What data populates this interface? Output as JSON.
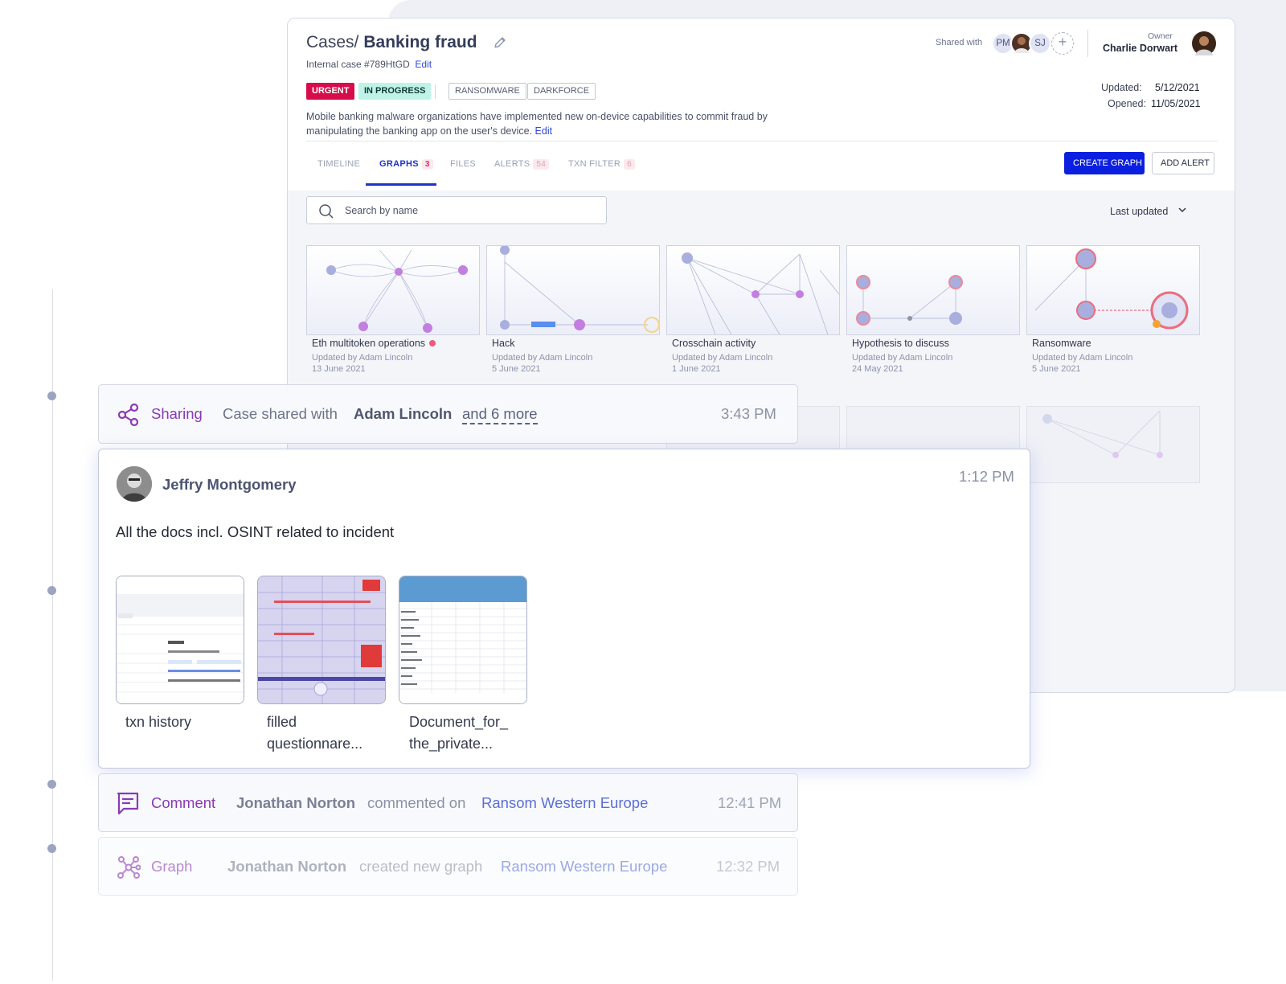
{
  "case": {
    "crumb": "Cases/",
    "title": "Banking fraud",
    "internal_label": "Internal case #789HtGD",
    "internal_edit": "Edit",
    "tags": {
      "urgent": "URGENT",
      "progress": "IN PROGRESS",
      "ransomware": "RANSOMWARE",
      "darkforce": "DARKFORCE"
    },
    "description": "Mobile banking malware organizations have implemented new on-device capabilities to commit fraud by manipulating the banking app on the user's device.",
    "description_edit": "Edit",
    "shared_with_label": "Shared with",
    "shared_avatars": [
      "PM",
      "SJ"
    ],
    "add_symbol": "+",
    "owner_label": "Owner",
    "owner_name": "Charlie Dorwart",
    "updated_label": "Updated:",
    "updated_value": "5/12/2021",
    "opened_label": "Opened:",
    "opened_value": "11/05/2021",
    "tabs": [
      {
        "label": "TIMELINE",
        "count": ""
      },
      {
        "label": "GRAPHS",
        "count": "3"
      },
      {
        "label": "FILES",
        "count": ""
      },
      {
        "label": "ALERTS",
        "count": "54"
      },
      {
        "label": "TXN FILTER",
        "count": "6"
      }
    ],
    "create_graph": "CREATE GRAPH",
    "add_alert": "ADD ALERT",
    "search_placeholder": "Search by name",
    "sort_label": "Last updated",
    "graphs": [
      {
        "name": "Eth multitoken operations",
        "by": "Updated by Adam Lincoln",
        "date": "13 June 2021"
      },
      {
        "name": "Hack",
        "by": "Updated by Adam Lincoln",
        "date": "5 June 2021"
      },
      {
        "name": "Crosschain activity",
        "by": "Updated by Adam Lincoln",
        "date": "1 June 2021"
      },
      {
        "name": "Hypothesis to discuss",
        "by": "Updated by Adam Lincoln",
        "date": "24 May 2021"
      },
      {
        "name": "Ransomware",
        "by": "Updated by Adam Lincoln",
        "date": "5 June 2021"
      }
    ]
  },
  "timeline": {
    "sharing": {
      "category": "Sharing",
      "text": "Case shared with",
      "user": "Adam Lincoln",
      "more": "and 6 more",
      "time": "3:43 PM"
    },
    "message": {
      "author": "Jeffry Montgomery",
      "time": "1:12 PM",
      "text": "All the docs incl. OSINT related to incident",
      "files": [
        {
          "name_line1": "txn history",
          "name_line2": ""
        },
        {
          "name_line1": "filled",
          "name_line2": "questionnare..."
        },
        {
          "name_line1": "Document_for_",
          "name_line2": "the_private..."
        }
      ]
    },
    "comment": {
      "category": "Comment",
      "user": "Jonathan Norton",
      "text": "commented on",
      "target": "Ransom Western Europe",
      "time": "12:41 PM"
    },
    "graph": {
      "category": "Graph",
      "user": "Jonathan Norton",
      "text": "created new graph",
      "target": "Ransom Western Europe",
      "time": "12:32 PM"
    }
  },
  "colors": {
    "accent": "#0b1fe0",
    "urgent": "#d70c4a",
    "in_progress": "#bff3e8",
    "event_category": "#8b39b4",
    "link": "#5b6fd6"
  }
}
